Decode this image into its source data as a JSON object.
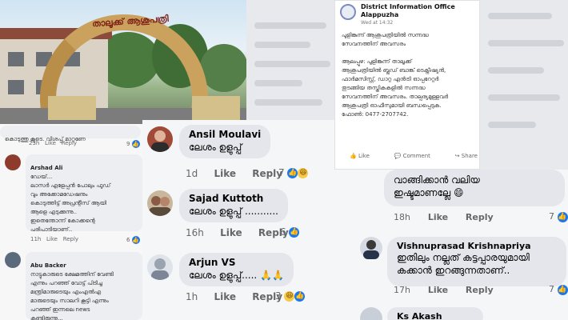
{
  "photo": {
    "arch_text": "താലൂക്ക് ആശുപത്രി"
  },
  "left_column": {
    "top_comment": {
      "text": "കൊടുത്തു കൂടെ. വിശപ്പ് മാറ്റണേ",
      "time": "23h",
      "like": "Like",
      "reply": "Reply",
      "count": "9"
    },
    "comment_arshad": {
      "name": "Arshad Ali",
      "text": "ഡേയ്...\nലാസർ എളേപ്പൻ പോലും ഫുഡ്\nവും അക്കോമഡേഷനും\nകൊടുത്തിട്ട് അപ്രന്റീസ് ആയി\nആളെ എടുക്കുന്നു..\nഇതെന്തോന്ന് കോക്കന്റെ\nപരിപാടിയാണ്..",
      "time": "11h",
      "like": "Like",
      "reply": "Reply",
      "count": "6"
    },
    "comment_abu": {
      "name": "Abu Backer",
      "text": "നാട്ടുകാരുടെ ക്ഷേമത്തിന് വേണ്ടി\nഎന്നും പറഞ്ഞ് വോട്ട് പിടിച്ച\nമന്ത്രിമാരുടെയും എംഎൽഎ\nമാരുടെയും സാലറി കൂട്ടി എന്നും\nപറഞ്ഞ് ഇന്നലെ news\nകണ്ടിരുന്നു..."
    }
  },
  "comments": [
    {
      "name": "Ansil Moulavi",
      "text": "ലേശം ഉളുപ്പ്",
      "time": "1d",
      "like": "Like",
      "reply": "Reply",
      "count": "7"
    },
    {
      "name": "Sajad Kuttoth",
      "text": "ലേശം ഉളുപ്പ് ...........",
      "time": "16h",
      "like": "Like",
      "reply": "Reply",
      "count": "6"
    },
    {
      "name": "Arjun VS",
      "text": "ലേശം ഉളുപ്പ്.....",
      "time": "1h",
      "like": "Like",
      "reply": "Reply",
      "count": "3"
    }
  ],
  "post": {
    "page_name": "District Information Office",
    "page_sub": "Alappuzha",
    "time": "Wed at 14:32",
    "body": "പുളിങ്കുന്ന് ആശുപത്രിയിൽ സന്നദ്ധ\nസേവനത്തിന് അവസരം\n\nആലപ്പുഴ: പുളിങ്കുന്ന് താലൂക്ക്\nആശുപത്രിയിൽ ബ്ലഡ് ബാങ്ക് ടെക്നീഷ്യൻ,\nഫാർമസിസ്റ്റ്, ഡാറ്റ എൻട്രി ഓപ്പറേറ്റർ\nതുടങ്ങിയ തസ്തികകളിൽ സന്നദ്ധ\nസേവനത്തിന് അവസരം. താല്പര്യമുള്ളവർ\nആശുപത്രി ഓഫീസുമായി ബന്ധപ്പെടുക.\nഫോൺ: 0477-2707742.",
    "like": "Like",
    "comment": "Comment",
    "share": "Share"
  },
  "right_column": {
    "top_comment": {
      "text_line1": "വാങ്ങിക്കാൻ വലിയ",
      "text_line2": "ഇഷ്ടമാണല്ലേ",
      "time": "18h",
      "like": "Like",
      "reply": "Reply",
      "count": "7"
    },
    "comment_vishnu": {
      "name": "Vishnuprasad Krishnapriya",
      "text_line1": "ഇതിലും നല്ലത് കട്ടപ്പാരയുമായി",
      "text_line2": "കക്കാൻ ഇറങ്ങുന്നതാണ്..",
      "time": "17h",
      "like": "Like",
      "reply": "Reply",
      "count": "7"
    },
    "comment_akash": {
      "name": "Ks Akash"
    }
  },
  "colors": {
    "facebook_blue": "#1877f2",
    "bubble_gray": "#e4e6eb",
    "meta_gray": "#65676b"
  }
}
